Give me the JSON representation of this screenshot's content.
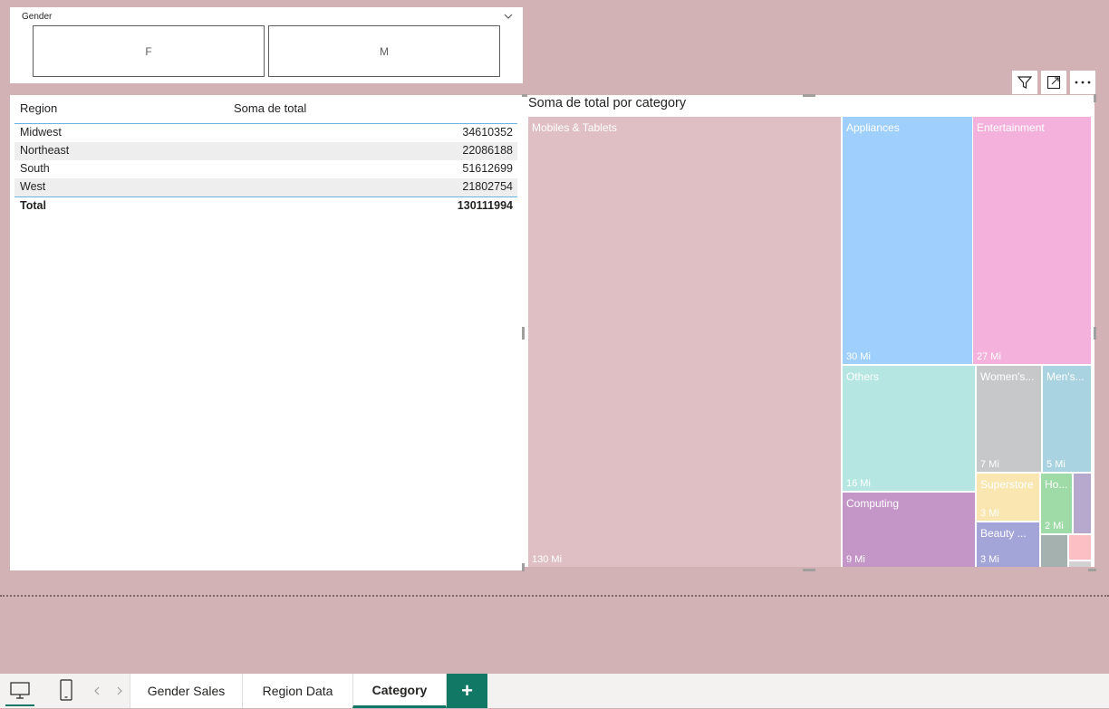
{
  "slicer": {
    "title": "Gender",
    "options": [
      "F",
      "M"
    ]
  },
  "table": {
    "headers": [
      "Region",
      "Soma de total"
    ],
    "rows": [
      {
        "region": "Midwest",
        "total": "34610352"
      },
      {
        "region": "Northeast",
        "total": "22086188"
      },
      {
        "region": "South",
        "total": "51612699"
      },
      {
        "region": "West",
        "total": "21802754"
      }
    ],
    "total_label": "Total",
    "total_value": "130111994"
  },
  "treemap": {
    "title": "Soma de total por category",
    "tiles": {
      "mobiles": {
        "name": "Mobiles & Tablets",
        "value": "130 Mi",
        "color": "#dfbfc3"
      },
      "appliances": {
        "name": "Appliances",
        "value": "30 Mi",
        "color": "#9fd0fd"
      },
      "entertainment": {
        "name": "Entertainment",
        "value": "27 Mi",
        "color": "#f4b1db"
      },
      "others": {
        "name": "Others",
        "value": "16 Mi",
        "color": "#b5e6e2"
      },
      "womens": {
        "name": "Women's...",
        "value": "7 Mi",
        "color": "#c7c8ca"
      },
      "mens": {
        "name": "Men's...",
        "value": "5 Mi",
        "color": "#aad3e1"
      },
      "computing": {
        "name": "Computing",
        "value": "9 Mi",
        "color": "#c496c8"
      },
      "superstore": {
        "name": "Superstore",
        "value": "3 Mi",
        "color": "#f9e6b0"
      },
      "ho": {
        "name": "Ho...",
        "value": "2 Mi",
        "color": "#9edba6"
      },
      "beauty": {
        "name": "Beauty ...",
        "value": "3 Mi",
        "color": "#a3a5d9"
      }
    },
    "small_colors": [
      "#b7a9cd",
      "#a4b1ae",
      "#fbbfc4",
      "#d2d2d2"
    ]
  },
  "tabs": [
    "Gender Sales",
    "Region Data",
    "Category"
  ],
  "add_tab_label": "+"
}
